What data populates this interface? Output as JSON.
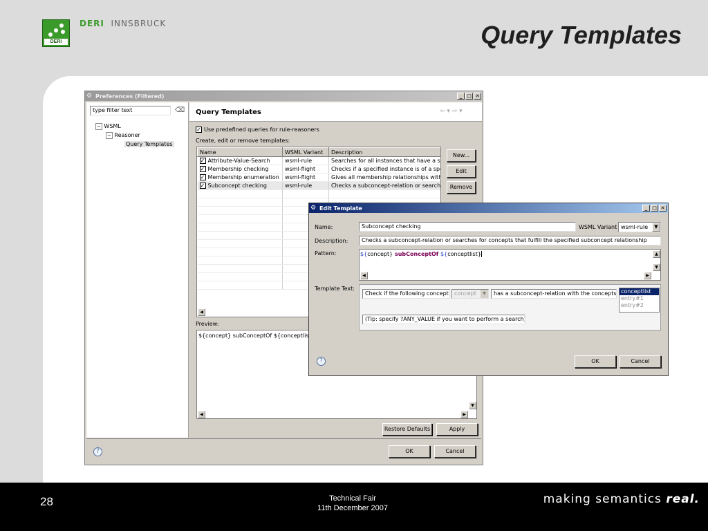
{
  "slide": {
    "title": "Query Templates",
    "brand_a": "DERI",
    "brand_b": "INNSBRUCK",
    "logo_text": "DERI",
    "page_number": "28",
    "event_line1": "Technical Fair",
    "event_line2": "11th December 2007",
    "tagline_prefix": "making semantics ",
    "tagline_bold": "real."
  },
  "prefs": {
    "title": "Preferences (Filtered)",
    "filter_placeholder": "type filter text",
    "tree": [
      "WSML",
      "Reasoner",
      "Query Templates"
    ],
    "page_title": "Query Templates",
    "checkbox_label": "Use predefined queries for rule-reasoners",
    "list_label": "Create, edit or remove templates:",
    "columns": [
      "Name",
      "WSML Variant",
      "Description"
    ],
    "rows": [
      {
        "name": "Attribute-Value-Search",
        "variant": "wsml-rule",
        "desc": "Searches for all instances that have a spe"
      },
      {
        "name": "Membership checking",
        "variant": "wsml-flight",
        "desc": "Checks if a specified instance is of a spec"
      },
      {
        "name": "Membership enumeration",
        "variant": "wsml-flight",
        "desc": "Gives all membership relationships within t"
      },
      {
        "name": "Subconcept checking",
        "variant": "wsml-rule",
        "desc": "Checks a subconcept-relation or searches"
      }
    ],
    "new_btn": "New...",
    "edit_btn": "Edit",
    "remove_btn": "Remove",
    "preview_label": "Preview:",
    "preview_text": "${concept} subConceptOf ${conceptlist}",
    "restore_btn": "Restore Defaults",
    "apply_btn": "Apply",
    "ok_btn": "OK",
    "cancel_btn": "Cancel"
  },
  "edit": {
    "title": "Edit Template",
    "name_label": "Name:",
    "name_value": "Subconcept checking",
    "variant_label": "WSML Variant",
    "variant_value": "wsml-rule",
    "desc_label": "Description:",
    "desc_value": "Checks a subconcept-relation or searches for concepts that fulfill the specified subconcept relationship",
    "pattern_label": "Pattern:",
    "pattern_a": "${",
    "pattern_b": "concept}",
    "pattern_c": " subConceptOf ",
    "pattern_d": "${",
    "pattern_e": "conceptlist}",
    "template_label": "Template Text:",
    "tt_part1": "Check if the following concept:",
    "tt_combo": "concept",
    "tt_part2": "has a subconcept-relation with the concepts:",
    "tt_list": [
      "conceptlist",
      "entry#1",
      "entry#2"
    ],
    "tip": "(Tip: specify ?ANY_VALUE if you want to perform a search)",
    "ok_btn": "OK",
    "cancel_btn": "Cancel"
  }
}
